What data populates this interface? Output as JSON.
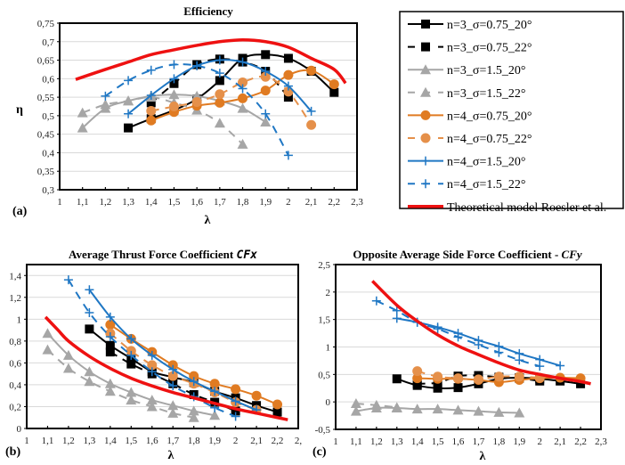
{
  "colors": {
    "black": "#000000",
    "gray": "#a6a6a6",
    "orange": "#e07b22",
    "orange_light": "#e5904a",
    "blue": "#1f77c4",
    "red": "#ee1111",
    "grid": "#d9d9d9"
  },
  "legend": {
    "entries": [
      {
        "label": "n=3_σ=0.75_20°",
        "color": "black",
        "dash": false,
        "marker": "square"
      },
      {
        "label": "n=3_σ=0.75_22°",
        "color": "black",
        "dash": true,
        "marker": "square"
      },
      {
        "label": "n=3_σ=1.5_20°",
        "color": "gray",
        "dash": false,
        "marker": "triangle"
      },
      {
        "label": "n=3_σ=1.5_22°",
        "color": "gray",
        "dash": true,
        "marker": "triangle"
      },
      {
        "label": "n=4_σ=0.75_20°",
        "color": "orange",
        "dash": false,
        "marker": "circle"
      },
      {
        "label": "n=4_σ=0.75_22°",
        "color": "orange_light",
        "dash": true,
        "marker": "circle"
      },
      {
        "label": "n=4_σ=1.5_20°",
        "color": "blue",
        "dash": false,
        "marker": "plus"
      },
      {
        "label": "n=4_σ=1.5_22°",
        "color": "blue",
        "dash": true,
        "marker": "plus"
      },
      {
        "label": "Theoretical model Roesler et al.",
        "color": "red",
        "dash": false,
        "marker": "none"
      }
    ]
  },
  "chart_data": [
    {
      "id": "a",
      "type": "line",
      "panel_label": "(a)",
      "title": "Efficiency",
      "xlabel": "λ",
      "ylabel": "η",
      "xlim": [
        1,
        2.3
      ],
      "ylim": [
        0.3,
        0.75
      ],
      "xticks": [
        "1",
        "1,1",
        "1,2",
        "1,3",
        "1,4",
        "1,5",
        "1,6",
        "1,7",
        "1,8",
        "1,9",
        "2",
        "2,1",
        "2,2",
        "2,3"
      ],
      "yticks": [
        "0,3",
        "0,35",
        "0,4",
        "0,45",
        "0,5",
        "0,55",
        "0,6",
        "0,65",
        "0,7",
        "0,75"
      ],
      "xtick_values": [
        1,
        1.1,
        1.2,
        1.3,
        1.4,
        1.5,
        1.6,
        1.7,
        1.8,
        1.9,
        2,
        2.1,
        2.2,
        2.3
      ],
      "ytick_values": [
        0.3,
        0.35,
        0.4,
        0.45,
        0.5,
        0.55,
        0.6,
        0.65,
        0.7,
        0.75
      ],
      "grid": true,
      "series": [
        {
          "name": "n=3_σ=0.75_20°",
          "x": [
            1.3,
            1.4,
            1.5,
            1.6,
            1.7,
            1.8,
            1.9,
            2.0,
            2.1,
            2.2
          ],
          "y": [
            0.467,
            0.492,
            0.515,
            0.545,
            0.595,
            0.655,
            0.665,
            0.655,
            0.62,
            0.563
          ]
        },
        {
          "name": "n=3_σ=0.75_22°",
          "x": [
            1.4,
            1.5,
            1.6,
            1.7,
            1.8,
            1.9,
            2.0
          ],
          "y": [
            0.535,
            0.587,
            0.638,
            0.653,
            0.645,
            0.62,
            0.55
          ]
        },
        {
          "name": "n=3_σ=1.5_20°",
          "x": [
            1.1,
            1.2,
            1.3,
            1.4,
            1.5,
            1.6,
            1.7,
            1.8,
            1.9
          ],
          "y": [
            0.467,
            0.52,
            0.54,
            0.553,
            0.557,
            0.553,
            0.54,
            0.52,
            0.483
          ]
        },
        {
          "name": "n=3_σ=1.5_22°",
          "x": [
            1.1,
            1.2,
            1.3,
            1.4,
            1.5,
            1.6,
            1.7,
            1.8
          ],
          "y": [
            0.508,
            0.53,
            0.54,
            0.55,
            0.535,
            0.515,
            0.48,
            0.423
          ]
        },
        {
          "name": "n=4_σ=0.75_20°",
          "x": [
            1.4,
            1.5,
            1.6,
            1.7,
            1.8,
            1.9,
            2.0,
            2.1,
            2.2
          ],
          "y": [
            0.487,
            0.51,
            0.527,
            0.535,
            0.547,
            0.568,
            0.61,
            0.622,
            0.585
          ]
        },
        {
          "name": "n=4_σ=0.75_22°",
          "x": [
            1.4,
            1.5,
            1.6,
            1.7,
            1.8,
            1.9,
            2.0,
            2.1
          ],
          "y": [
            0.513,
            0.525,
            0.537,
            0.558,
            0.59,
            0.605,
            0.565,
            0.475
          ]
        },
        {
          "name": "n=4_σ=1.5_20°",
          "x": [
            1.3,
            1.4,
            1.5,
            1.6,
            1.7,
            1.8,
            1.9,
            2.0,
            2.1
          ],
          "y": [
            0.505,
            0.555,
            0.6,
            0.635,
            0.65,
            0.645,
            0.62,
            0.58,
            0.512
          ]
        },
        {
          "name": "n=4_σ=1.5_22°",
          "x": [
            1.2,
            1.3,
            1.4,
            1.5,
            1.6,
            1.7,
            1.8,
            1.9,
            2.0
          ],
          "y": [
            0.553,
            0.595,
            0.623,
            0.638,
            0.635,
            0.615,
            0.573,
            0.505,
            0.393
          ]
        },
        {
          "name": "Theoretical model Roesler et al.",
          "x": [
            1.07,
            1.2,
            1.3,
            1.4,
            1.5,
            1.6,
            1.7,
            1.8,
            1.9,
            2.0,
            2.1,
            2.2,
            2.25
          ],
          "y": [
            0.598,
            0.625,
            0.645,
            0.665,
            0.678,
            0.69,
            0.7,
            0.705,
            0.7,
            0.685,
            0.655,
            0.625,
            0.588
          ]
        }
      ]
    },
    {
      "id": "b",
      "type": "line",
      "panel_label": "(b)",
      "title": "Average Thrust Force Coefficient ",
      "title_italic": "CFx",
      "xlabel": "λ",
      "ylabel": "",
      "xlim": [
        1,
        2.3
      ],
      "ylim": [
        0,
        1.5
      ],
      "xticks": [
        "1",
        "1,1",
        "1,2",
        "1,3",
        "1,4",
        "1,5",
        "1,6",
        "1,7",
        "1,8",
        "1,9",
        "2",
        "2,1",
        "2,2",
        "2,"
      ],
      "yticks": [
        "0",
        "0,2",
        "0,4",
        "0,6",
        "0,8",
        "1",
        "1,2",
        "1,4"
      ],
      "xtick_values": [
        1,
        1.1,
        1.2,
        1.3,
        1.4,
        1.5,
        1.6,
        1.7,
        1.8,
        1.9,
        2,
        2.1,
        2.2,
        2.3
      ],
      "ytick_values": [
        0,
        0.2,
        0.4,
        0.6,
        0.8,
        1.0,
        1.2,
        1.4
      ],
      "grid": true,
      "series": [
        {
          "name": "n=3_σ=0.75_20°",
          "x": [
            1.3,
            1.4,
            1.5,
            1.6,
            1.7,
            1.8,
            1.9,
            2.0,
            2.1,
            2.2
          ],
          "y": [
            0.91,
            0.76,
            0.64,
            0.52,
            0.47,
            0.42,
            0.34,
            0.28,
            0.21,
            0.15
          ]
        },
        {
          "name": "n=3_σ=0.75_22°",
          "x": [
            1.4,
            1.5,
            1.6,
            1.7,
            1.8,
            1.9,
            2.0
          ],
          "y": [
            0.7,
            0.59,
            0.5,
            0.41,
            0.31,
            0.24,
            0.16
          ]
        },
        {
          "name": "n=3_σ=1.5_20°",
          "x": [
            1.1,
            1.2,
            1.3,
            1.4,
            1.5,
            1.6,
            1.7,
            1.8,
            1.9
          ],
          "y": [
            0.87,
            0.67,
            0.52,
            0.41,
            0.33,
            0.26,
            0.21,
            0.16,
            0.12
          ]
        },
        {
          "name": "n=3_σ=1.5_22°",
          "x": [
            1.1,
            1.2,
            1.3,
            1.4,
            1.5,
            1.6,
            1.7,
            1.8
          ],
          "y": [
            0.72,
            0.55,
            0.43,
            0.34,
            0.26,
            0.2,
            0.14,
            0.1
          ]
        },
        {
          "name": "n=4_σ=0.75_20°",
          "x": [
            1.4,
            1.5,
            1.6,
            1.7,
            1.8,
            1.9,
            2.0,
            2.1,
            2.2
          ],
          "y": [
            0.95,
            0.82,
            0.7,
            0.58,
            0.48,
            0.41,
            0.36,
            0.3,
            0.22
          ]
        },
        {
          "name": "n=4_σ=0.75_22°",
          "x": [
            1.4,
            1.5,
            1.6,
            1.7,
            1.8,
            1.9,
            2.0,
            2.1
          ],
          "y": [
            0.87,
            0.71,
            0.58,
            0.48,
            0.41,
            0.33,
            0.24,
            0.17
          ]
        },
        {
          "name": "n=4_σ=1.5_20°",
          "x": [
            1.3,
            1.4,
            1.5,
            1.6,
            1.7,
            1.8,
            1.9,
            2.0,
            2.1
          ],
          "y": [
            1.27,
            1.02,
            0.82,
            0.67,
            0.54,
            0.43,
            0.34,
            0.25,
            0.17
          ]
        },
        {
          "name": "n=4_σ=1.5_22°",
          "x": [
            1.2,
            1.3,
            1.4,
            1.5,
            1.6,
            1.7,
            1.8,
            1.9,
            2.0
          ],
          "y": [
            1.36,
            1.06,
            0.84,
            0.67,
            0.52,
            0.39,
            0.29,
            0.19,
            0.11
          ]
        },
        {
          "name": "Theoretical model Roesler et al.",
          "x": [
            1.09,
            1.15,
            1.2,
            1.3,
            1.4,
            1.5,
            1.6,
            1.7,
            1.8,
            1.9,
            2.0,
            2.1,
            2.2,
            2.25
          ],
          "y": [
            1.02,
            0.9,
            0.8,
            0.66,
            0.55,
            0.46,
            0.39,
            0.33,
            0.28,
            0.23,
            0.18,
            0.14,
            0.1,
            0.08
          ]
        }
      ]
    },
    {
      "id": "c",
      "type": "line",
      "panel_label": "(c)",
      "title": "Opposite Average Side Force Coefficient  - ",
      "title_italic": "CFy",
      "xlabel": "λ",
      "ylabel": "",
      "xlim": [
        1,
        2.3
      ],
      "ylim": [
        -0.5,
        2.5
      ],
      "xticks": [
        "1",
        "1,1",
        "1,2",
        "1,3",
        "1,4",
        "1,5",
        "1,6",
        "1,7",
        "1,8",
        "1,9",
        "2",
        "2,1",
        "2,2",
        "2,3"
      ],
      "yticks": [
        "-0,5",
        "0",
        "0,5",
        "1",
        "1,5",
        "2",
        "2,5"
      ],
      "xtick_values": [
        1,
        1.1,
        1.2,
        1.3,
        1.4,
        1.5,
        1.6,
        1.7,
        1.8,
        1.9,
        2,
        2.1,
        2.2,
        2.3
      ],
      "ytick_values": [
        -0.5,
        0,
        0.5,
        1,
        1.5,
        2,
        2.5
      ],
      "grid": true,
      "series": [
        {
          "name": "n=3_σ=0.75_20°",
          "x": [
            1.3,
            1.4,
            1.5,
            1.6,
            1.7,
            1.8,
            1.9,
            2.0,
            2.1,
            2.2
          ],
          "y": [
            0.42,
            0.3,
            0.25,
            0.26,
            0.33,
            0.42,
            0.44,
            0.42,
            0.38,
            0.33
          ]
        },
        {
          "name": "n=3_σ=0.75_22°",
          "x": [
            1.4,
            1.5,
            1.6,
            1.7,
            1.8,
            1.9,
            2.0
          ],
          "y": [
            0.33,
            0.35,
            0.47,
            0.48,
            0.45,
            0.43,
            0.38
          ]
        },
        {
          "name": "n=3_σ=1.5_20°",
          "x": [
            1.1,
            1.2,
            1.3,
            1.4,
            1.5,
            1.6,
            1.7,
            1.8,
            1.9
          ],
          "y": [
            -0.17,
            -0.11,
            -0.11,
            -0.13,
            -0.13,
            -0.15,
            -0.17,
            -0.19,
            -0.2
          ]
        },
        {
          "name": "n=3_σ=1.5_22°",
          "x": [
            1.1,
            1.2,
            1.3
          ],
          "y": [
            -0.03,
            -0.06,
            -0.1
          ]
        },
        {
          "name": "n=4_σ=0.75_20°",
          "x": [
            1.4,
            1.5,
            1.6,
            1.7,
            1.8,
            1.9,
            2.0,
            2.1,
            2.2
          ],
          "y": [
            0.43,
            0.42,
            0.42,
            0.4,
            0.36,
            0.4,
            0.43,
            0.44,
            0.43
          ]
        },
        {
          "name": "n=4_σ=0.75_22°",
          "x": [
            1.4,
            1.5,
            1.6,
            1.7,
            1.8,
            1.9,
            2.0
          ],
          "y": [
            0.56,
            0.46,
            0.43,
            0.41,
            0.46,
            0.46,
            0.44
          ]
        },
        {
          "name": "n=4_σ=1.5_20°",
          "x": [
            1.3,
            1.4,
            1.5,
            1.6,
            1.7,
            1.8,
            1.9,
            2.0,
            2.1
          ],
          "y": [
            1.52,
            1.45,
            1.36,
            1.25,
            1.12,
            1.01,
            0.88,
            0.77,
            0.66
          ]
        },
        {
          "name": "n=4_σ=1.5_22°",
          "x": [
            1.2,
            1.3,
            1.4,
            1.5,
            1.6,
            1.7,
            1.8,
            1.9,
            2.0
          ],
          "y": [
            1.84,
            1.66,
            1.45,
            1.33,
            1.18,
            1.04,
            0.9,
            0.76,
            0.65
          ]
        },
        {
          "name": "Theoretical model Roesler et al.",
          "x": [
            1.18,
            1.3,
            1.4,
            1.5,
            1.6,
            1.7,
            1.8,
            1.9,
            2.0,
            2.1,
            2.2,
            2.25
          ],
          "y": [
            2.2,
            1.76,
            1.47,
            1.22,
            1.02,
            0.86,
            0.71,
            0.58,
            0.5,
            0.43,
            0.37,
            0.33
          ]
        }
      ]
    }
  ]
}
